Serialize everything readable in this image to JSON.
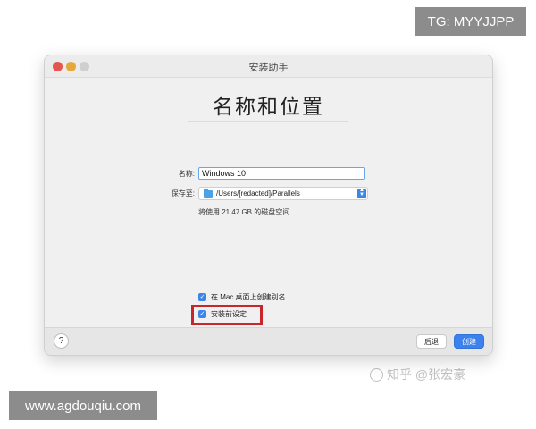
{
  "overlays": {
    "tg_label": "TG: MYYJJPP",
    "site_label": "www.agdouqiu.com",
    "watermark": "知乎 @张宏豪"
  },
  "window": {
    "title": "安装助手",
    "heading": "名称和位置"
  },
  "form": {
    "name_label": "名称:",
    "name_value": "Windows 10",
    "save_label": "保存至:",
    "save_path": "/Users/[redacted]/Parallels",
    "disk_note": "将使用 21.47 GB 的磁盘空间"
  },
  "options": {
    "alias_label": "在 Mac 桌面上创建别名",
    "alias_checked": true,
    "customize_label": "安装前设定",
    "customize_checked": true
  },
  "footer": {
    "help_label": "?",
    "back_label": "后退",
    "create_label": "创建"
  },
  "colors": {
    "accent": "#3b82ef",
    "highlight_box": "#c9252c"
  }
}
